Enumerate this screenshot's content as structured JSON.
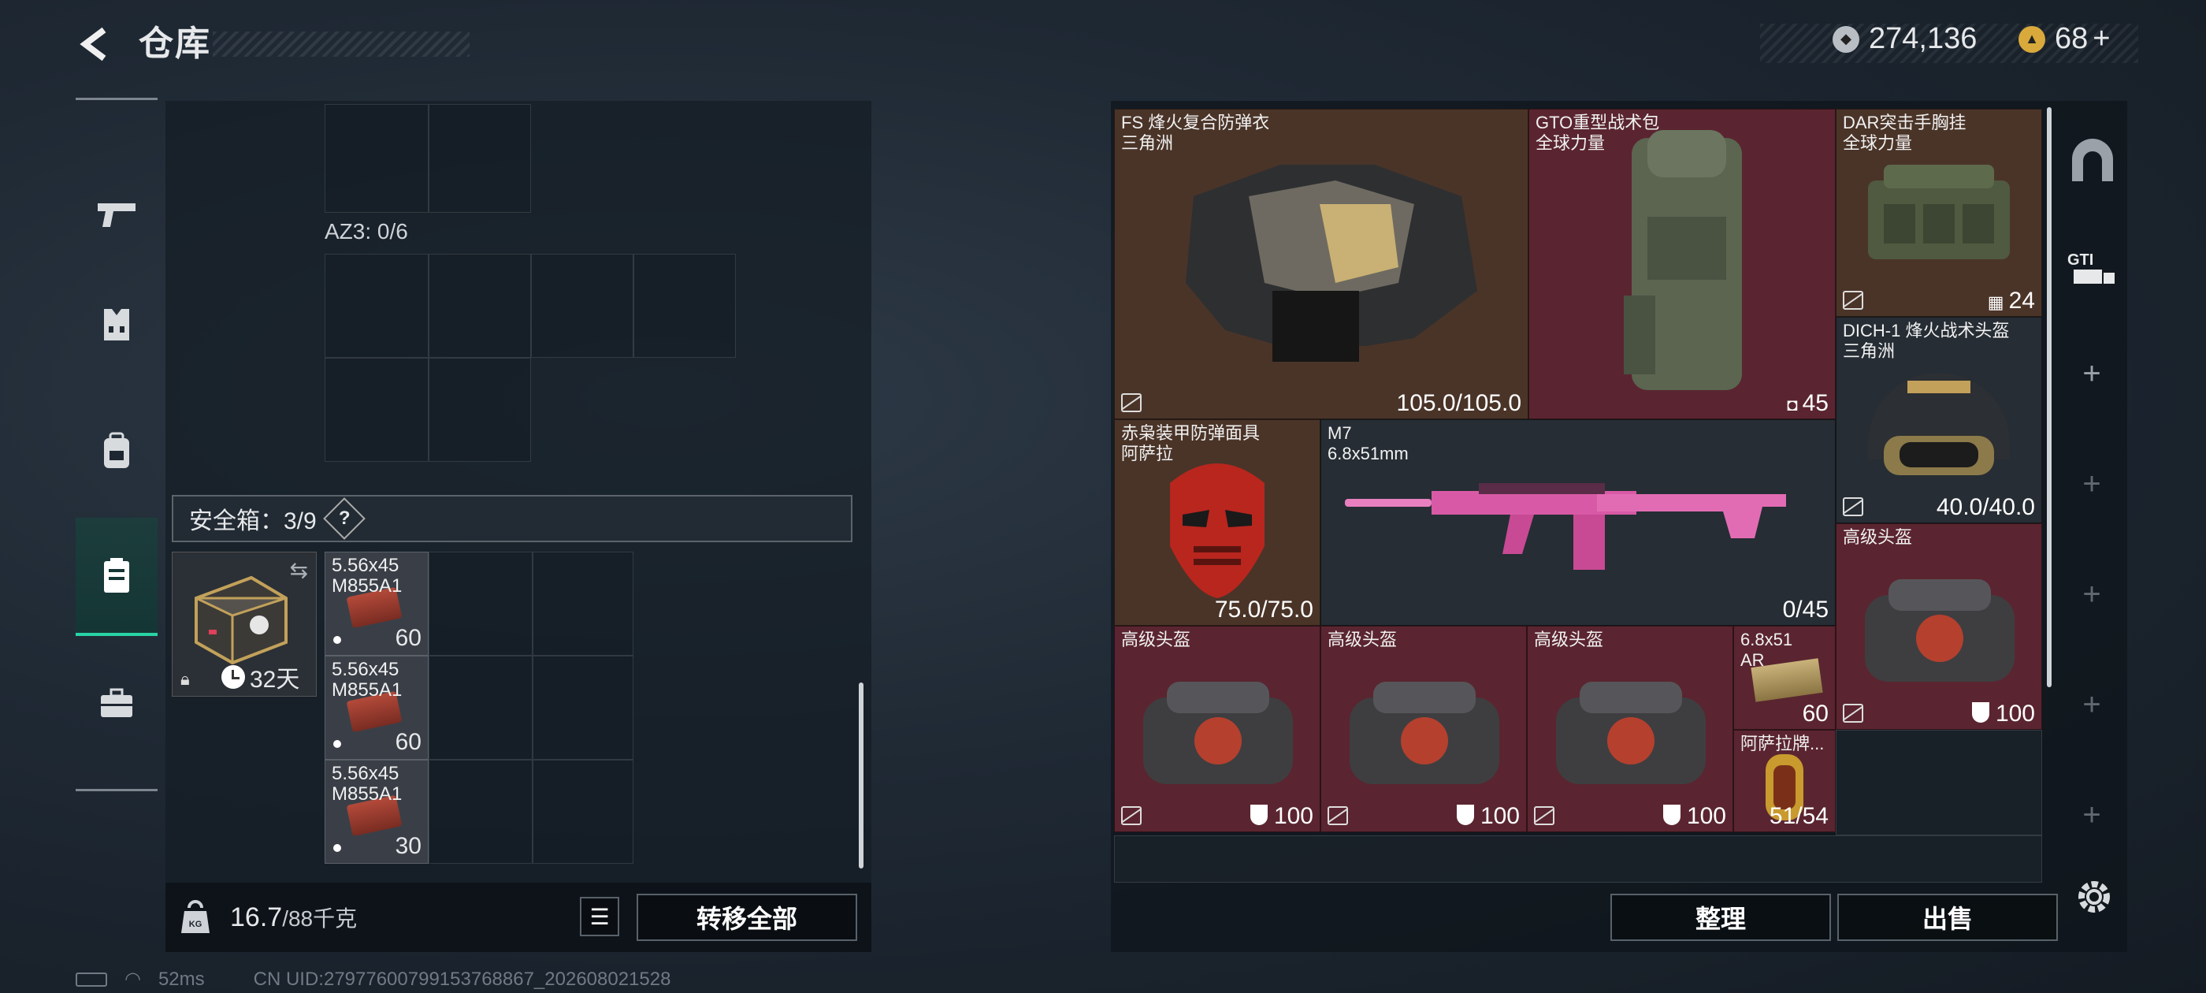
{
  "header": {
    "title": "仓库"
  },
  "currency": {
    "silver": "274,136",
    "gold": "68"
  },
  "nav": {
    "items": [
      "weapons",
      "armor",
      "backpack",
      "safebox",
      "toolbox"
    ]
  },
  "left": {
    "container_label": "AZ3: 0/6",
    "safebox_label": "安全箱：3/9",
    "safebox_help": "?",
    "safebox_days": "32天",
    "ammo": [
      {
        "name": "5.56x45\nM855A1",
        "count": "60"
      },
      {
        "name": "5.56x45\nM855A1",
        "count": "60"
      },
      {
        "name": "5.56x45\nM855A1",
        "count": "30"
      }
    ],
    "weight": "16.7",
    "weight_max": "/88千克",
    "transfer_all": "转移全部"
  },
  "right": {
    "items": [
      {
        "name": "FS 烽火复合防弹衣\n三角洲",
        "value": "105.0/105.0"
      },
      {
        "name": "GTO重型战术包\n全球力量",
        "value": "45"
      },
      {
        "name": "DAR突击手胸挂\n全球力量",
        "value": "24"
      },
      {
        "name": "DICH-1 烽火战术头盔\n三角洲",
        "value": "40.0/40.0"
      },
      {
        "name": "赤枭装甲防弹面具\n阿萨拉",
        "value": "75.0/75.0"
      },
      {
        "name": "M7\n6.8x51mm",
        "value": "0/45"
      },
      {
        "name": "高级头盔",
        "value": "100"
      },
      {
        "name": "高级头盔",
        "value": "100"
      },
      {
        "name": "高级头盔",
        "value": "100"
      },
      {
        "name": "高级头盔",
        "value": "100"
      },
      {
        "name": "6.8x51\nAR",
        "value": "60"
      },
      {
        "name": "阿萨拉牌...",
        "value": "51/54"
      }
    ],
    "sort_btn": "整理",
    "sell_btn": "出售"
  },
  "footer": {
    "ping": "52ms",
    "uid": "CN UID:27977600799153768867_202608021528"
  }
}
